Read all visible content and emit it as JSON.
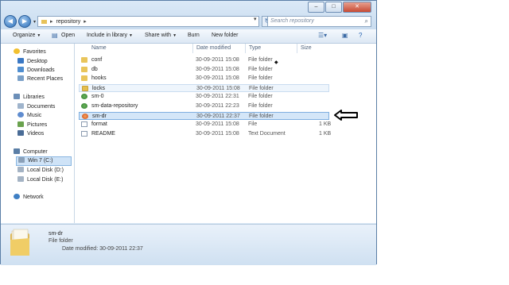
{
  "address": {
    "path": "repository",
    "search_placeholder": "Search repository"
  },
  "toolbar": {
    "organize": "Organize",
    "open": "Open",
    "include": "Include in library",
    "share": "Share with",
    "burn": "Burn",
    "new_folder": "New folder"
  },
  "sidebar": {
    "favorites": "Favorites",
    "desktop": "Desktop",
    "downloads": "Downloads",
    "recent": "Recent Places",
    "libraries": "Libraries",
    "documents": "Documents",
    "music": "Music",
    "pictures": "Pictures",
    "videos": "Videos",
    "computer": "Computer",
    "win7": "Win 7 (C:)",
    "disk_d": "Local Disk (D:)",
    "disk_e": "Local Disk (E:)",
    "network": "Network"
  },
  "columns": {
    "name": "Name",
    "date": "Date modified",
    "type": "Type",
    "size": "Size"
  },
  "files": [
    {
      "name": "conf",
      "date": "30-09-2011 15:08",
      "type": "File folder",
      "size": "",
      "icon": "folder"
    },
    {
      "name": "db",
      "date": "30-09-2011 15:08",
      "type": "File folder",
      "size": "",
      "icon": "folder"
    },
    {
      "name": "hooks",
      "date": "30-09-2011 15:08",
      "type": "File folder",
      "size": "",
      "icon": "folder"
    },
    {
      "name": "locks",
      "date": "30-09-2011 15:08",
      "type": "File folder",
      "size": "",
      "icon": "folder"
    },
    {
      "name": "sm-0",
      "date": "30-09-2011 22:31",
      "type": "File folder",
      "size": "",
      "icon": "green-overlay-folder"
    },
    {
      "name": "sm-data-repository",
      "date": "30-09-2011 22:23",
      "type": "File folder",
      "size": "",
      "icon": "green-overlay-folder"
    },
    {
      "name": "sm-dr",
      "date": "30-09-2011 22:37",
      "type": "File folder",
      "size": "",
      "icon": "orange-overlay-folder"
    },
    {
      "name": "format",
      "date": "30-09-2011 15:08",
      "type": "File",
      "size": "1 KB",
      "icon": "file"
    },
    {
      "name": "README",
      "date": "30-09-2011 15:08",
      "type": "Text Document",
      "size": "1 KB",
      "icon": "text-file"
    }
  ],
  "details": {
    "name": "sm-dr",
    "type": "File folder",
    "modified": "Date modified: 30-09-2011 22:37"
  }
}
